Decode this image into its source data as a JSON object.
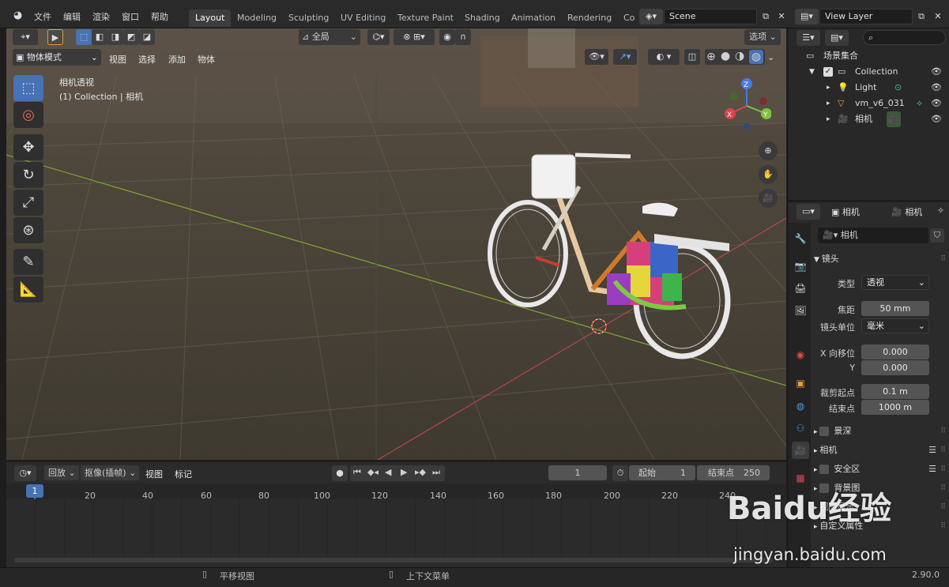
{
  "topbar": {
    "menus": [
      "文件",
      "编辑",
      "渲染",
      "窗口",
      "帮助"
    ],
    "workspaces": [
      "Layout",
      "Modeling",
      "Sculpting",
      "UV Editing",
      "Texture Paint",
      "Shading",
      "Animation",
      "Rendering",
      "Co"
    ],
    "active_workspace": "Layout",
    "scene": "Scene",
    "view_layer": "View Layer"
  },
  "viewport": {
    "mode": "物体模式",
    "menus": [
      "视图",
      "选择",
      "添加",
      "物体"
    ],
    "transform_orientation": "全局",
    "options": "选项",
    "overlay_title": "相机透视",
    "overlay_sub": "(1) Collection | 相机"
  },
  "outliner": {
    "root": "场景集合",
    "collection": "Collection",
    "items": [
      "Light",
      "vm_v6_031",
      "相机"
    ]
  },
  "properties": {
    "tab_object": "相机",
    "tab_data": "相机",
    "data_name": "相机",
    "section_lens": "镜头",
    "type_label": "类型",
    "type_value": "透视",
    "focal_label": "焦距",
    "focal_value": "50 mm",
    "lens_unit_label": "镜头单位",
    "lens_unit_value": "毫米",
    "shift_x_label": "X 向移位",
    "shift_x_value": "0.000",
    "shift_y_label": "Y",
    "shift_y_value": "0.000",
    "clip_start_label": "裁剪起点",
    "clip_start_value": "0.1 m",
    "clip_end_label": "结束点",
    "clip_end_value": "1000 m",
    "sections": [
      "景深",
      "相机",
      "安全区",
      "背景图",
      "视图显示",
      "自定义属性"
    ]
  },
  "timeline": {
    "playback": "回放",
    "keying": "抠像(插帧)",
    "view": "视图",
    "marker": "标记",
    "current_frame": "1",
    "start_label": "起始",
    "start_value": "1",
    "end_label": "结束点",
    "end_value": "250",
    "ticks": [
      "1",
      "20",
      "40",
      "60",
      "80",
      "100",
      "120",
      "140",
      "160",
      "180",
      "200",
      "220",
      "240"
    ]
  },
  "statusbar": {
    "pan": "平移视图",
    "context": "上下文菜单",
    "version": "2.90.0"
  },
  "watermark": {
    "brand": "Baidu经验",
    "url": "jingyan.baidu.com"
  }
}
